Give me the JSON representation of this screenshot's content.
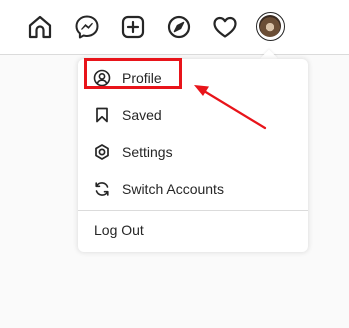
{
  "nav": {
    "icons": [
      "home-icon",
      "messenger-icon",
      "new-post-icon",
      "explore-icon",
      "activity-heart-icon",
      "profile-avatar"
    ]
  },
  "menu": {
    "items": [
      {
        "label": "Profile",
        "icon": "profile-icon"
      },
      {
        "label": "Saved",
        "icon": "bookmark-icon"
      },
      {
        "label": "Settings",
        "icon": "settings-gear-icon"
      },
      {
        "label": "Switch Accounts",
        "icon": "switch-accounts-icon"
      }
    ],
    "logout_label": "Log Out"
  },
  "annotation": {
    "highlight_color": "#e8141a"
  }
}
